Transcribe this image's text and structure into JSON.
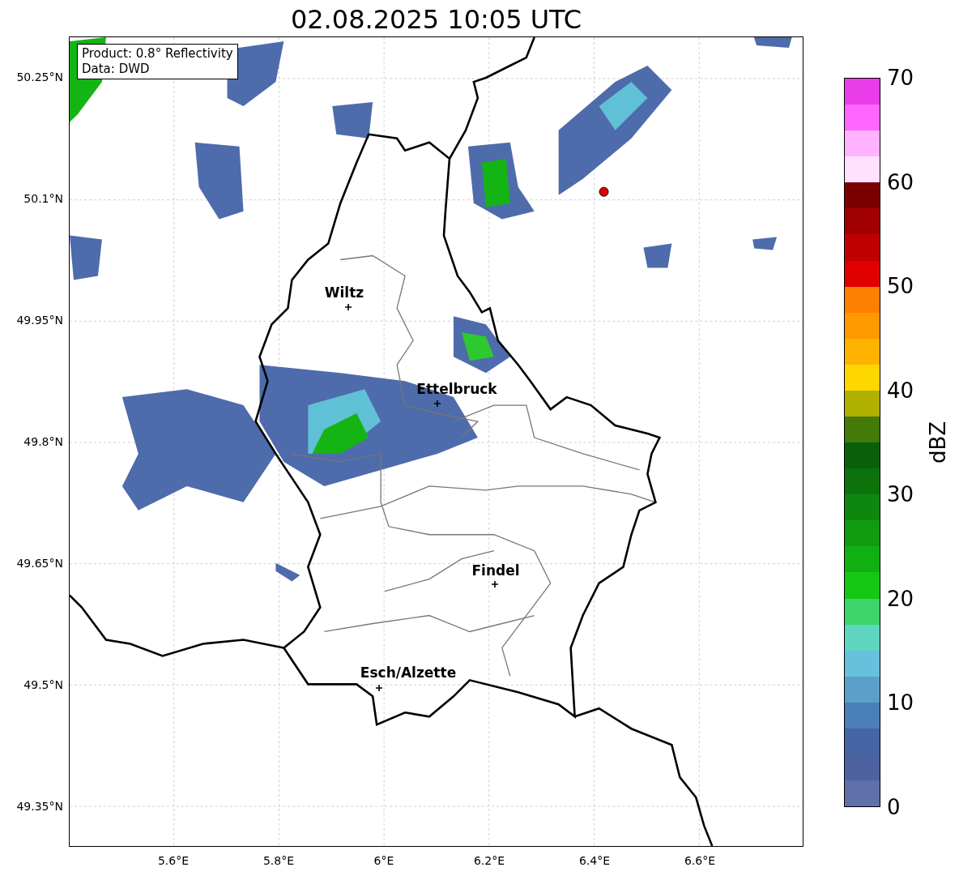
{
  "title": "02.08.2025 10:05 UTC",
  "info_box": {
    "lines": [
      "Product: 0.8° Reflectivity",
      "Data: DWD"
    ]
  },
  "map": {
    "lat_ticks": [
      "50.25°N",
      "50.1°N",
      "49.95°N",
      "49.8°N",
      "49.65°N",
      "49.5°N",
      "49.35°N"
    ],
    "lon_ticks": [
      "5.6°E",
      "5.8°E",
      "6°E",
      "6.2°E",
      "6.4°E",
      "6.6°E"
    ],
    "cities": [
      {
        "name": "Wiltz"
      },
      {
        "name": "Ettelbruck"
      },
      {
        "name": "Findel"
      },
      {
        "name": "Esch/Alzette"
      }
    ]
  },
  "colorbar": {
    "label": "dBZ",
    "ticks": [
      "70",
      "60",
      "50",
      "40",
      "30",
      "20",
      "10",
      "0"
    ],
    "bands": [
      {
        "color": "#e93de9"
      },
      {
        "color": "#ff66ff"
      },
      {
        "color": "#ffb3ff"
      },
      {
        "color": "#ffe0ff"
      },
      {
        "color": "#7a0000"
      },
      {
        "color": "#a00000"
      },
      {
        "color": "#c00000"
      },
      {
        "color": "#e00000"
      },
      {
        "color": "#ff7f00"
      },
      {
        "color": "#ff9900"
      },
      {
        "color": "#ffb300"
      },
      {
        "color": "#ffd700"
      },
      {
        "color": "#b0b000"
      },
      {
        "color": "#437a0a"
      },
      {
        "color": "#0a5f0a"
      },
      {
        "color": "#0c730c"
      },
      {
        "color": "#0e870e"
      },
      {
        "color": "#109b10"
      },
      {
        "color": "#12af12"
      },
      {
        "color": "#14c814"
      },
      {
        "color": "#3dd66b"
      },
      {
        "color": "#5fd6c0"
      },
      {
        "color": "#68c0dc"
      },
      {
        "color": "#5ba0c8"
      },
      {
        "color": "#4a7fb8"
      },
      {
        "color": "#4565a5"
      },
      {
        "color": "#4e62a0"
      },
      {
        "color": "#6070a8"
      }
    ]
  }
}
